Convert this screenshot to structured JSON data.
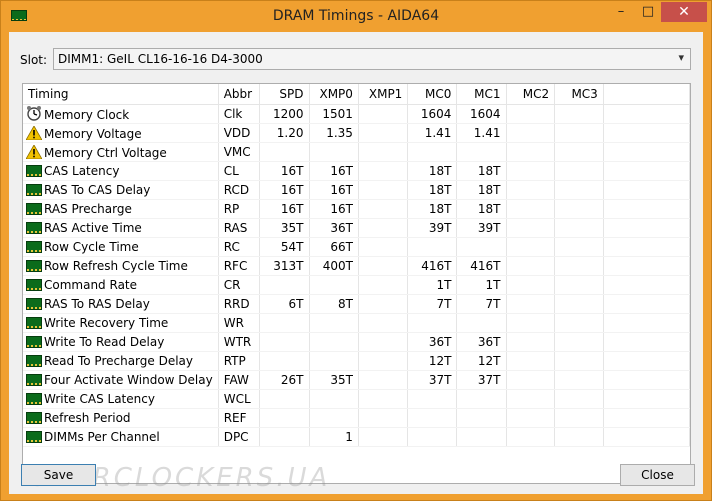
{
  "window": {
    "title": "DRAM Timings - AIDA64",
    "minimize": "–",
    "maximize": "□",
    "close": "✕"
  },
  "slot": {
    "label": "Slot:",
    "value": "DIMM1: GeIL CL16-16-16 D4-3000"
  },
  "columns": [
    "Timing",
    "Abbr",
    "SPD",
    "XMP0",
    "XMP1",
    "MC0",
    "MC1",
    "MC2",
    "MC3"
  ],
  "rows": [
    {
      "icon": "clock-icon",
      "name": "Memory Clock",
      "abbr": "Clk",
      "spd": "1200",
      "xmp0": "1501",
      "xmp1": "",
      "mc0": "1604",
      "mc1": "1604",
      "mc2": "",
      "mc3": ""
    },
    {
      "icon": "warning-icon",
      "name": "Memory Voltage",
      "abbr": "VDD",
      "spd": "1.20",
      "xmp0": "1.35",
      "xmp1": "",
      "mc0": "1.41",
      "mc1": "1.41",
      "mc2": "",
      "mc3": ""
    },
    {
      "icon": "warning-icon",
      "name": "Memory Ctrl Voltage",
      "abbr": "VMC",
      "spd": "",
      "xmp0": "",
      "xmp1": "",
      "mc0": "",
      "mc1": "",
      "mc2": "",
      "mc3": ""
    },
    {
      "icon": "ram-icon",
      "name": "CAS Latency",
      "abbr": "CL",
      "spd": "16T",
      "xmp0": "16T",
      "xmp1": "",
      "mc0": "18T",
      "mc1": "18T",
      "mc2": "",
      "mc3": ""
    },
    {
      "icon": "ram-icon",
      "name": "RAS To CAS Delay",
      "abbr": "RCD",
      "spd": "16T",
      "xmp0": "16T",
      "xmp1": "",
      "mc0": "18T",
      "mc1": "18T",
      "mc2": "",
      "mc3": ""
    },
    {
      "icon": "ram-icon",
      "name": "RAS Precharge",
      "abbr": "RP",
      "spd": "16T",
      "xmp0": "16T",
      "xmp1": "",
      "mc0": "18T",
      "mc1": "18T",
      "mc2": "",
      "mc3": ""
    },
    {
      "icon": "ram-icon",
      "name": "RAS Active Time",
      "abbr": "RAS",
      "spd": "35T",
      "xmp0": "36T",
      "xmp1": "",
      "mc0": "39T",
      "mc1": "39T",
      "mc2": "",
      "mc3": ""
    },
    {
      "icon": "ram-icon",
      "name": "Row Cycle Time",
      "abbr": "RC",
      "spd": "54T",
      "xmp0": "66T",
      "xmp1": "",
      "mc0": "",
      "mc1": "",
      "mc2": "",
      "mc3": ""
    },
    {
      "icon": "ram-icon",
      "name": "Row Refresh Cycle Time",
      "abbr": "RFC",
      "spd": "313T",
      "xmp0": "400T",
      "xmp1": "",
      "mc0": "416T",
      "mc1": "416T",
      "mc2": "",
      "mc3": ""
    },
    {
      "icon": "ram-icon",
      "name": "Command Rate",
      "abbr": "CR",
      "spd": "",
      "xmp0": "",
      "xmp1": "",
      "mc0": "1T",
      "mc1": "1T",
      "mc2": "",
      "mc3": ""
    },
    {
      "icon": "ram-icon",
      "name": "RAS To RAS Delay",
      "abbr": "RRD",
      "spd": "6T",
      "xmp0": "8T",
      "xmp1": "",
      "mc0": "7T",
      "mc1": "7T",
      "mc2": "",
      "mc3": ""
    },
    {
      "icon": "ram-icon",
      "name": "Write Recovery Time",
      "abbr": "WR",
      "spd": "",
      "xmp0": "",
      "xmp1": "",
      "mc0": "",
      "mc1": "",
      "mc2": "",
      "mc3": ""
    },
    {
      "icon": "ram-icon",
      "name": "Write To Read Delay",
      "abbr": "WTR",
      "spd": "",
      "xmp0": "",
      "xmp1": "",
      "mc0": "36T",
      "mc1": "36T",
      "mc2": "",
      "mc3": ""
    },
    {
      "icon": "ram-icon",
      "name": "Read To Precharge Delay",
      "abbr": "RTP",
      "spd": "",
      "xmp0": "",
      "xmp1": "",
      "mc0": "12T",
      "mc1": "12T",
      "mc2": "",
      "mc3": ""
    },
    {
      "icon": "ram-icon",
      "name": "Four Activate Window Delay",
      "abbr": "FAW",
      "spd": "26T",
      "xmp0": "35T",
      "xmp1": "",
      "mc0": "37T",
      "mc1": "37T",
      "mc2": "",
      "mc3": ""
    },
    {
      "icon": "ram-icon",
      "name": "Write CAS Latency",
      "abbr": "WCL",
      "spd": "",
      "xmp0": "",
      "xmp1": "",
      "mc0": "",
      "mc1": "",
      "mc2": "",
      "mc3": ""
    },
    {
      "icon": "ram-icon",
      "name": "Refresh Period",
      "abbr": "REF",
      "spd": "",
      "xmp0": "",
      "xmp1": "",
      "mc0": "",
      "mc1": "",
      "mc2": "",
      "mc3": ""
    },
    {
      "icon": "ram-icon",
      "name": "DIMMs Per Channel",
      "abbr": "DPC",
      "spd": "",
      "xmp0": "1",
      "xmp1": "",
      "mc0": "",
      "mc1": "",
      "mc2": "",
      "mc3": ""
    }
  ],
  "buttons": {
    "save": "Save",
    "close": "Close"
  },
  "watermark": "OVERCLOCKERS.UA",
  "colors": {
    "titlebar": "#f0a030",
    "close_button": "#c7504a",
    "ram_icon": "#0b6b1b",
    "warning": "#f2c200"
  }
}
